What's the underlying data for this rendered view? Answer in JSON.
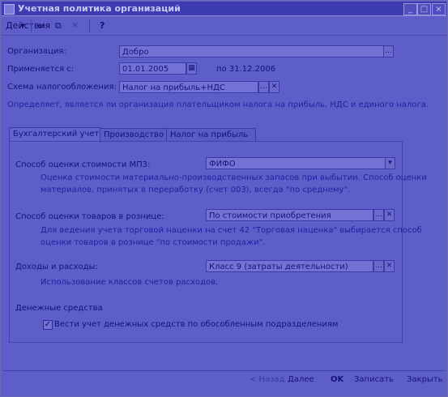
{
  "window": {
    "title": "Учетная политика организаций"
  },
  "toolbar": {
    "actions_label": "Действия",
    "help_label": "?"
  },
  "form": {
    "org_label": "Организация:",
    "org_value": "Добро",
    "applied_label": "Применяется с:",
    "date_from": "01.01.2005",
    "date_to_label": "по 31.12.2006",
    "tax_label": "Схема налогообложения:",
    "tax_value": "Налог на прибыль+НДС",
    "tax_hint": "Определяет, является ли организация плательщиком налога на прибыль, НДС и единого налога."
  },
  "tabs": [
    {
      "label": "Бухгалтерский учет"
    },
    {
      "label": "Производство"
    },
    {
      "label": "Налог на прибыль"
    }
  ],
  "accounting": {
    "mpz_label": "Способ оценки стоимости МПЗ:",
    "mpz_value": "ФИФО",
    "mpz_hint_1": "Оценка стоимости материально-производственных запасов при выбытии. Способ оценки",
    "mpz_hint_2": "материалов, принятых в переработку (счет 003), всегда \"по среднему\".",
    "retail_label": "Способ оценки товаров в рознице:",
    "retail_value": "По стоимости приобретения",
    "retail_hint_1": "Для ведения учета торговой наценки на счет 42 \"Торговая наценка\" выбирается способ",
    "retail_hint_2": "оценки товаров в рознице \"по стоимости продажи\".",
    "income_label": "Доходы и расходы:",
    "income_value": "Класс 9 (затраты деятельности)",
    "income_hint": "Использование классов счетов расходов.",
    "cash_section": "Денежные средства",
    "cash_checkbox": "Вести учет денежных средств по обособленным подразделениям"
  },
  "footer": {
    "back": "< Назад",
    "next": "Далее",
    "ok": "OK",
    "save": "Записать",
    "close": "Закрыть"
  }
}
